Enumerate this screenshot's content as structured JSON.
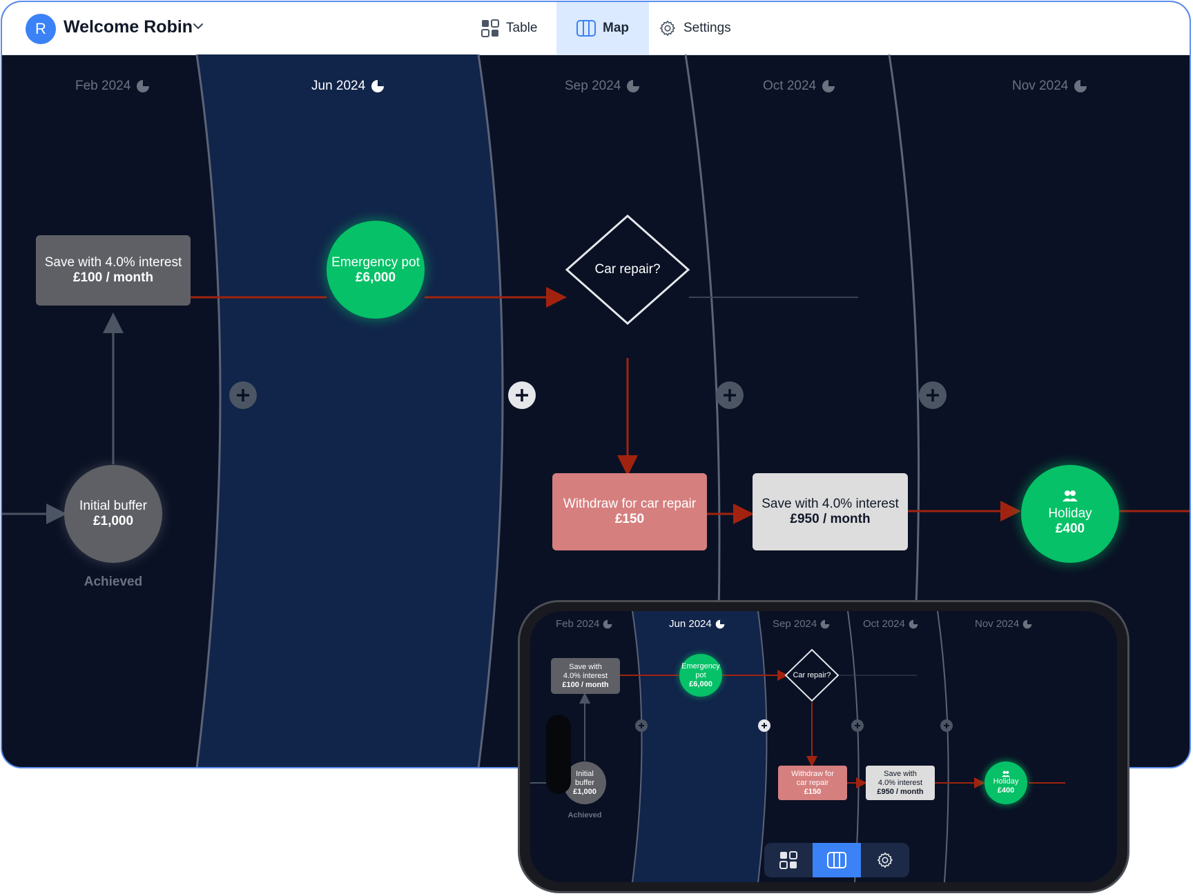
{
  "header": {
    "avatar_initial": "R",
    "welcome": "Welcome Robin",
    "tabs": [
      {
        "label": "Table",
        "icon": "grid-icon"
      },
      {
        "label": "Map",
        "icon": "map-icon",
        "active": true
      },
      {
        "label": "Settings",
        "icon": "gear-icon"
      }
    ]
  },
  "months": [
    "Feb 2024",
    "Jun 2024",
    "Sep 2024",
    "Oct 2024",
    "Nov 2024"
  ],
  "active_month": "Jun 2024",
  "nodes": {
    "save_100": {
      "line1": "Save with 4.0% interest",
      "line2": "£100 / month"
    },
    "emergency": {
      "line1": "Emergency pot",
      "line2": "£6,000"
    },
    "car_repair": {
      "label": "Car repair?"
    },
    "initial": {
      "line1": "Initial buffer",
      "line2": "£1,000",
      "status": "Achieved"
    },
    "withdraw": {
      "line1": "Withdraw for car repair",
      "line2": "£150"
    },
    "save_950": {
      "line1": "Save with 4.0% interest",
      "line2": "£950 / month"
    },
    "holiday": {
      "line1": "Holiday",
      "line2": "£400",
      "icon": "people-icon"
    }
  },
  "phone": {
    "save_100": {
      "l1": "Save with",
      "l2": "4.0% interest",
      "l3": "£100 / month"
    },
    "emergency": {
      "l1": "Emergency",
      "l2": "pot",
      "l3": "£6,000"
    },
    "initial": {
      "l1": "Initial",
      "l2": "buffer",
      "l3": "£1,000"
    },
    "withdraw": {
      "l1": "Withdraw for",
      "l2": "car repair",
      "l3": "£150"
    },
    "save_950": {
      "l1": "Save with",
      "l2": "4.0% interest",
      "l3": "£950 / month"
    }
  },
  "colors": {
    "background": "#0a1124",
    "active_band": "#11244a",
    "green": "#06c167",
    "grey_node": "#5f6066",
    "withdraw": "#d67f7f",
    "light_node": "#dddddd",
    "arrow": "#a1230f",
    "accent": "#3b82f6"
  }
}
